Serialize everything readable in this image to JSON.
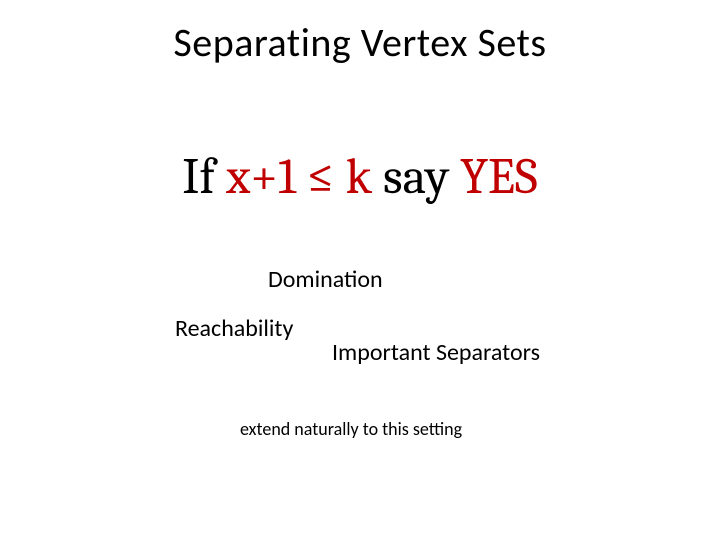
{
  "title": "Separating Vertex Sets",
  "formula": {
    "word_if": "If ",
    "expr_lhs": "x+1 ",
    "op_leq": "≤",
    "expr_rhs": " k ",
    "word_say": "say ",
    "word_yes": "YES"
  },
  "labels": {
    "domination": "Domination",
    "reachability": "Reachability",
    "important_separators": "Important Separators",
    "extend": "extend naturally to this setting"
  }
}
